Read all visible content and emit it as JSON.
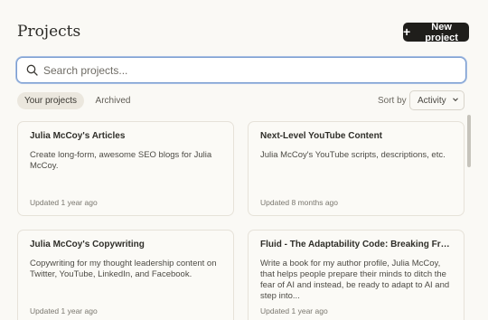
{
  "header": {
    "title": "Projects",
    "new_button_label": "New project"
  },
  "search": {
    "placeholder": "Search projects..."
  },
  "tabs": [
    {
      "label": "Your projects",
      "active": true
    },
    {
      "label": "Archived",
      "active": false
    }
  ],
  "sort": {
    "label": "Sort by",
    "value": "Activity"
  },
  "projects": [
    {
      "title": "Julia McCoy's Articles",
      "description": "Create long-form, awesome SEO blogs for Julia McCoy.",
      "updated": "Updated 1 year ago"
    },
    {
      "title": "Next-Level YouTube Content",
      "description": "Julia McCoy's YouTube scripts, descriptions, etc.",
      "updated": "Updated 8 months ago"
    },
    {
      "title": "Julia McCoy's Copywriting",
      "description": "Copywriting for my thought leadership content on Twitter, YouTube, LinkedIn, and Facebook.",
      "updated": "Updated 1 year ago"
    },
    {
      "title": "Fluid - The Adaptability Code: Breaking Free f...",
      "description": "Write a book for my author profile, Julia McCoy, that helps people prepare their minds to ditch the fear of AI and instead, be ready to adapt to AI and step into...",
      "updated": "Updated 1 year ago"
    }
  ],
  "colors": {
    "background": "#faf9f5",
    "primary_button": "#1f1e1b",
    "search_focus": "#7a9dd0"
  }
}
